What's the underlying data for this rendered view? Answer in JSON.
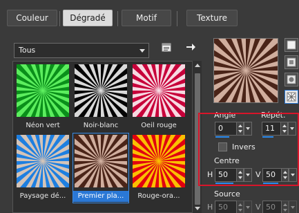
{
  "tabs": [
    {
      "label": "Couleur",
      "active": false
    },
    {
      "label": "Dégradé",
      "active": true
    },
    {
      "label": "Motif",
      "active": false
    },
    {
      "label": "Texture",
      "active": false
    }
  ],
  "filter": {
    "selected": "Tous"
  },
  "gradients": [
    {
      "label": "Néon vert",
      "colors": [
        "#0a8f1a",
        "#6bff6b"
      ],
      "selected": false
    },
    {
      "label": "Noir-blanc",
      "colors": [
        "#050505",
        "#ffffff"
      ],
      "selected": false
    },
    {
      "label": "Oeil rouge",
      "colors": [
        "#c7003a",
        "#ffffff"
      ],
      "selected": false
    },
    {
      "label": "Paysage dé...",
      "colors": [
        "#1e7fe0",
        "#f4d0b0"
      ],
      "selected": false
    },
    {
      "label": "Premier pla...",
      "colors": [
        "#4a2418",
        "#e7c7b6"
      ],
      "selected": true
    },
    {
      "label": "Rouge-ora...",
      "colors": [
        "#e00010",
        "#ffe000"
      ],
      "selected": false
    }
  ],
  "preview": {
    "colors": [
      "#4a2418",
      "#e7c7b6"
    ]
  },
  "angle": {
    "label": "Angle",
    "value": "0"
  },
  "repeat": {
    "label": "Répét.",
    "value": "11"
  },
  "invert": {
    "label": "Invers",
    "checked": false
  },
  "centre": {
    "label": "Centre",
    "h_label": "H",
    "h_value": "50",
    "v_label": "V",
    "v_value": "50"
  },
  "source": {
    "label": "Source",
    "h_label": "H",
    "h_value": "50",
    "v_label": "V",
    "v_value": "50"
  },
  "colors": {
    "accent": "#2a78d6",
    "highlight_box": "#d9152a"
  }
}
